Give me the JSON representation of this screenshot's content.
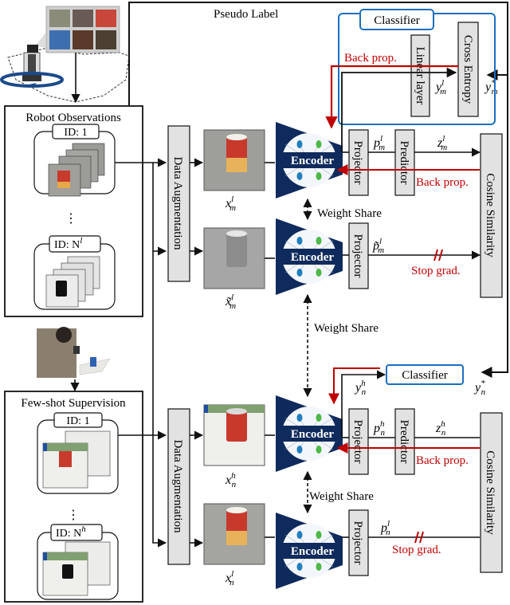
{
  "colors": {
    "line": "#111111",
    "backprop": "#c00000",
    "classifier_border": "#1a6fc0",
    "encoder_fill": "#0f2a5c",
    "block_fill": "#e2e2e2"
  },
  "top": {
    "pseudo_label": "Pseudo Label",
    "classifier_title": "Classifier",
    "linear_layer": "Linear layer",
    "cross_entropy": "Cross Entropy",
    "back_prop": "Back prop.",
    "y_m_l": "y",
    "y_m_l_sup": "l",
    "y_m_l_sub": "m",
    "y_m_star": "y",
    "y_m_star_sup": "*",
    "y_m_star_sub": "m"
  },
  "robot_observations": {
    "title": "Robot Observations",
    "id_first": "ID: 1",
    "id_last": "ID: N",
    "id_last_sup": "l",
    "ellipsis": "⋮"
  },
  "few_shot": {
    "title": "Few-shot Supervision",
    "id_first": "ID: 1",
    "id_last": "ID: N",
    "id_last_sup": "h",
    "ellipsis": "⋮"
  },
  "data_augmentation": "Data Augmentation",
  "encoder_label": "Encoder",
  "projector_label": "Projector",
  "predictor_label": "Predictor",
  "cosine_similarity": "Cosine Similarity",
  "weight_share": "Weight Share",
  "back_prop": "Back prop.",
  "stop_grad": "Stop grad.",
  "classifier_bottom": "Classifier",
  "variables": {
    "x_m_l": {
      "base": "x",
      "sup": "l",
      "sub": "m"
    },
    "x_m_l_tilde": {
      "base": "x̃",
      "sup": "l",
      "sub": "m"
    },
    "x_n_h": {
      "base": "x",
      "sup": "h",
      "sub": "n"
    },
    "x_n_l": {
      "base": "x",
      "sup": "l",
      "sub": "n"
    },
    "p_m_l": {
      "base": "p",
      "sup": "l",
      "sub": "m"
    },
    "z_m_l": {
      "base": "z",
      "sup": "l",
      "sub": "m"
    },
    "p_m_l_tilde": {
      "base": "p̃",
      "sup": "l",
      "sub": "m"
    },
    "p_n_h": {
      "base": "p",
      "sup": "h",
      "sub": "n"
    },
    "z_n_h": {
      "base": "z",
      "sup": "h",
      "sub": "n"
    },
    "p_n_l": {
      "base": "p",
      "sup": "l",
      "sub": "n"
    },
    "y_n_h": {
      "base": "y",
      "sup": "h",
      "sub": "n"
    },
    "y_n_star": {
      "base": "y",
      "sup": "*",
      "sub": "n"
    }
  }
}
